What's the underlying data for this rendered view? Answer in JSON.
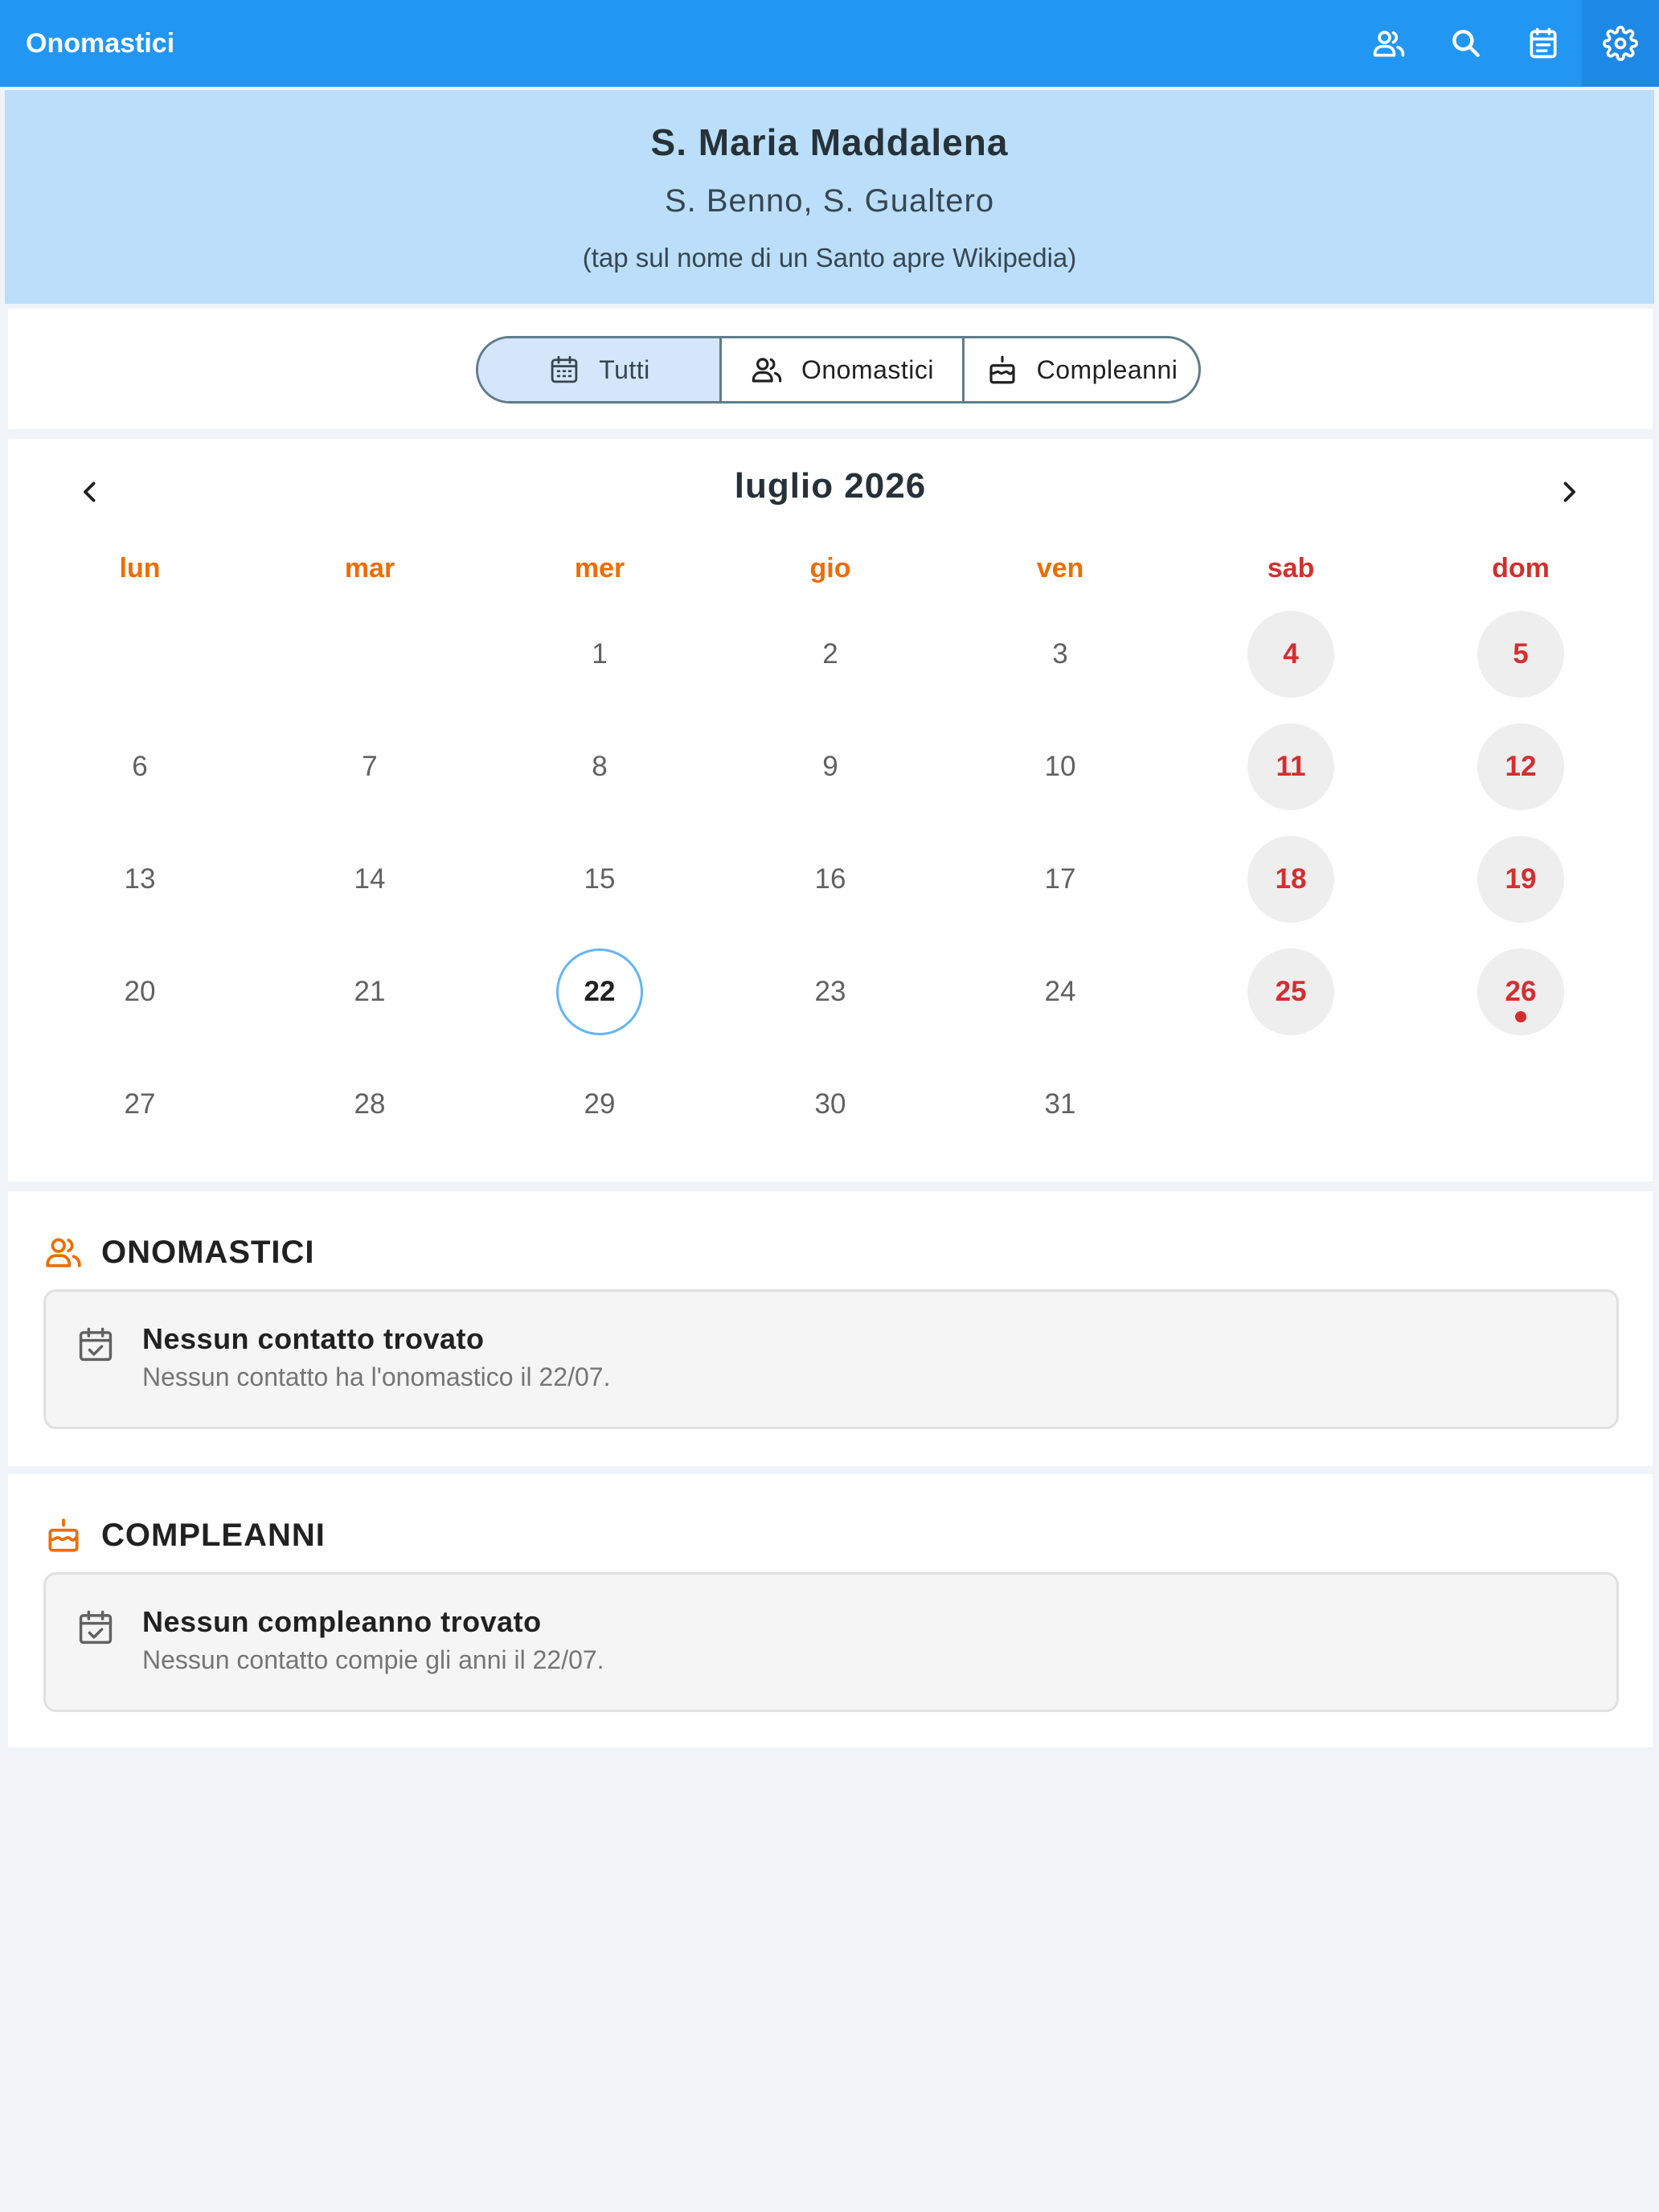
{
  "app": {
    "title": "Onomastici",
    "actions": [
      {
        "icon": "contacts-icon"
      },
      {
        "icon": "search-icon"
      },
      {
        "icon": "calendar-note-icon"
      },
      {
        "icon": "gear-icon"
      }
    ],
    "colors": {
      "primary": "#2196f3",
      "accent": "#ef6c00",
      "weekend": "#d32f2f",
      "header_bg": "#bbdefb"
    }
  },
  "saint": {
    "main": "S. Maria Maddalena",
    "others": "S. Benno, S. Gualtero",
    "hint": "(tap sul nome di un Santo apre Wikipedia)"
  },
  "filter": {
    "options": [
      {
        "label": "Tutti",
        "icon": "calendar-icon",
        "selected": true
      },
      {
        "label": "Onomastici",
        "icon": "people-icon",
        "selected": false
      },
      {
        "label": "Compleanni",
        "icon": "cake-icon",
        "selected": false
      }
    ]
  },
  "calendar": {
    "month_title": "luglio 2026",
    "weekdays": [
      "lun",
      "mar",
      "mer",
      "gio",
      "ven",
      "sab",
      "dom"
    ],
    "first_weekday_index": 2,
    "days_in_month": 31,
    "today": 22,
    "marked_days": [
      26
    ]
  },
  "onomastici": {
    "title": "ONOMASTICI",
    "empty_title": "Nessun contatto trovato",
    "empty_subtitle": "Nessun contatto ha l'onomastico il 22/07."
  },
  "compleanni": {
    "title": "COMPLEANNI",
    "empty_title": "Nessun compleanno trovato",
    "empty_subtitle": "Nessun contatto compie gli anni il 22/07."
  }
}
